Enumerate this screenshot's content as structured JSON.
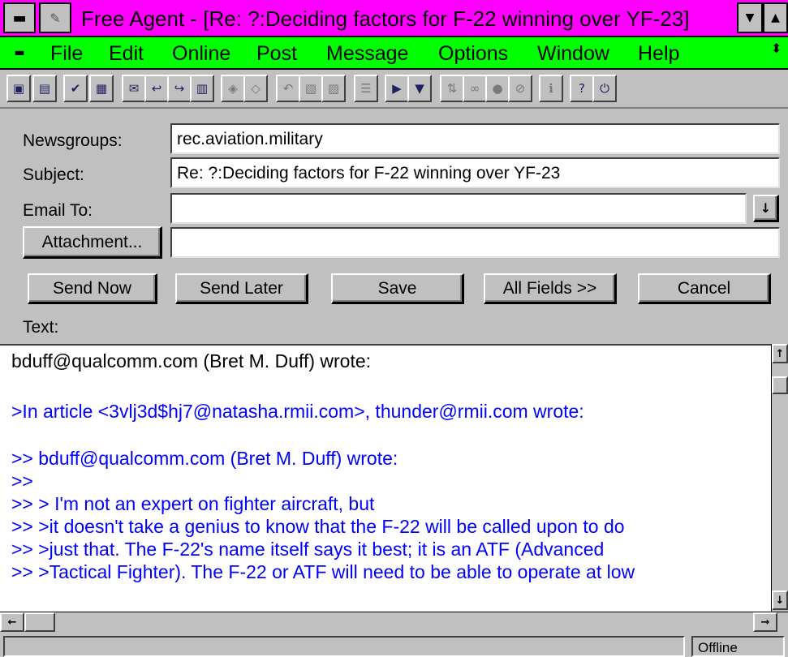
{
  "window": {
    "title": "Free Agent - [Re: ?:Deciding factors for F-22 winning over YF-23]"
  },
  "menu": {
    "items": [
      {
        "label": "File"
      },
      {
        "label": "Edit"
      },
      {
        "label": "Online"
      },
      {
        "label": "Post"
      },
      {
        "label": "Message"
      },
      {
        "label": "Options"
      },
      {
        "label": "Window"
      },
      {
        "label": "Help"
      }
    ]
  },
  "toolbar": {
    "icons": [
      "newsgroups-icon",
      "folder-icon",
      "check-articles-icon",
      "articles-icon",
      "new-post-icon",
      "reply-icon",
      "forward-icon",
      "follow-icon",
      "tag-icon",
      "untag-icon",
      "undo-icon",
      "save-icon",
      "print-icon",
      "list-icon",
      "flashlight-icon",
      "filter-icon",
      "sort-icon",
      "link-icon",
      "lock-icon",
      "stop-icon",
      "info-icon",
      "help-icon",
      "off-icon"
    ]
  },
  "form": {
    "newsgroups_label": "Newsgroups:",
    "newsgroups_value": "rec.aviation.military",
    "subject_label": "Subject:",
    "subject_value": "Re: ?:Deciding factors for F-22 winning over YF-23",
    "email_label": "Email To:",
    "email_value": "",
    "attachment_button": "Attachment...",
    "attachment_value": "",
    "text_label": "Text:"
  },
  "buttons": {
    "send_now": "Send Now",
    "send_later": "Send Later",
    "save": "Save",
    "all_fields": "All Fields >>",
    "cancel": "Cancel"
  },
  "message": {
    "lines": [
      {
        "text": "bduff@qualcomm.com (Bret M. Duff) wrote:",
        "quoted": false
      },
      {
        "text": "",
        "quoted": false
      },
      {
        "text": ">In article <3vlj3d$hj7@natasha.rmii.com>, thunder@rmii.com wrote:",
        "quoted": true
      },
      {
        "text": "",
        "quoted": false
      },
      {
        "text": ">> bduff@qualcomm.com (Bret M. Duff) wrote:",
        "quoted": true
      },
      {
        "text": ">>",
        "quoted": true
      },
      {
        "text": ">> > I'm not an expert on fighter aircraft, but",
        "quoted": true
      },
      {
        "text": ">> >it doesn't take a genius to know that the F-22 will be called upon to do",
        "quoted": true
      },
      {
        "text": ">> >just that. The F-22's name itself says it best; it is an ATF (Advanced",
        "quoted": true
      },
      {
        "text": ">> >Tactical Fighter). The F-22 or ATF will need to be able to operate at low",
        "quoted": true
      }
    ]
  },
  "status": {
    "mode": "Offline"
  },
  "colors": {
    "titlebar": "#ff00ff",
    "menubar": "#00ff00",
    "quoted_text": "#0000ff",
    "chrome": "#c0c0c0"
  }
}
